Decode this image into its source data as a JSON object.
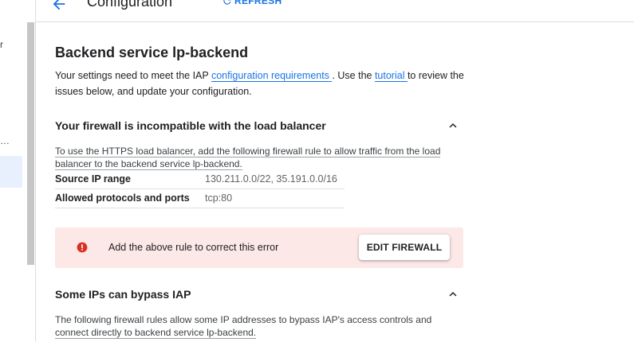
{
  "leftnav": {
    "fragment_top": "r",
    "fragment_mid": "…"
  },
  "header": {
    "title": "Configuration",
    "refresh_label": "REFRESH"
  },
  "main": {
    "title": "Backend service lp-backend",
    "intro": {
      "text1": "Your settings need to meet the IAP ",
      "link1": "configuration requirements ",
      "text2": ". Use the ",
      "link2": "tutorial ",
      "text3": " to review the issues below, and update your configuration."
    },
    "firewall_section": {
      "title": "Your firewall is incompatible with the load balancer",
      "desc1": "To use the HTTPS load balancer, add the following firewall rule to allow traffic from the load",
      "desc2": "balancer to the backend service lp-backend.",
      "rows": [
        {
          "key": "Source IP range",
          "value": "130.211.0.0/22, 35.191.0.0/16"
        },
        {
          "key": "Allowed protocols and ports",
          "value": "tcp:80"
        }
      ],
      "error_text": "Add the above rule to correct this error",
      "button_label": "EDIT FIREWALL"
    },
    "bypass_section": {
      "title": "Some IPs can bypass IAP",
      "desc1": "The following firewall rules allow some IP addresses to bypass IAP's access controls and",
      "desc2": "connect directly to backend service lp-backend."
    }
  },
  "colors": {
    "accent": "#1a73e8",
    "error": "#d93025",
    "error_bg": "#fce8e6",
    "scrollbar": "#c6c6c6",
    "nav_selected": "#e8f0fe"
  }
}
